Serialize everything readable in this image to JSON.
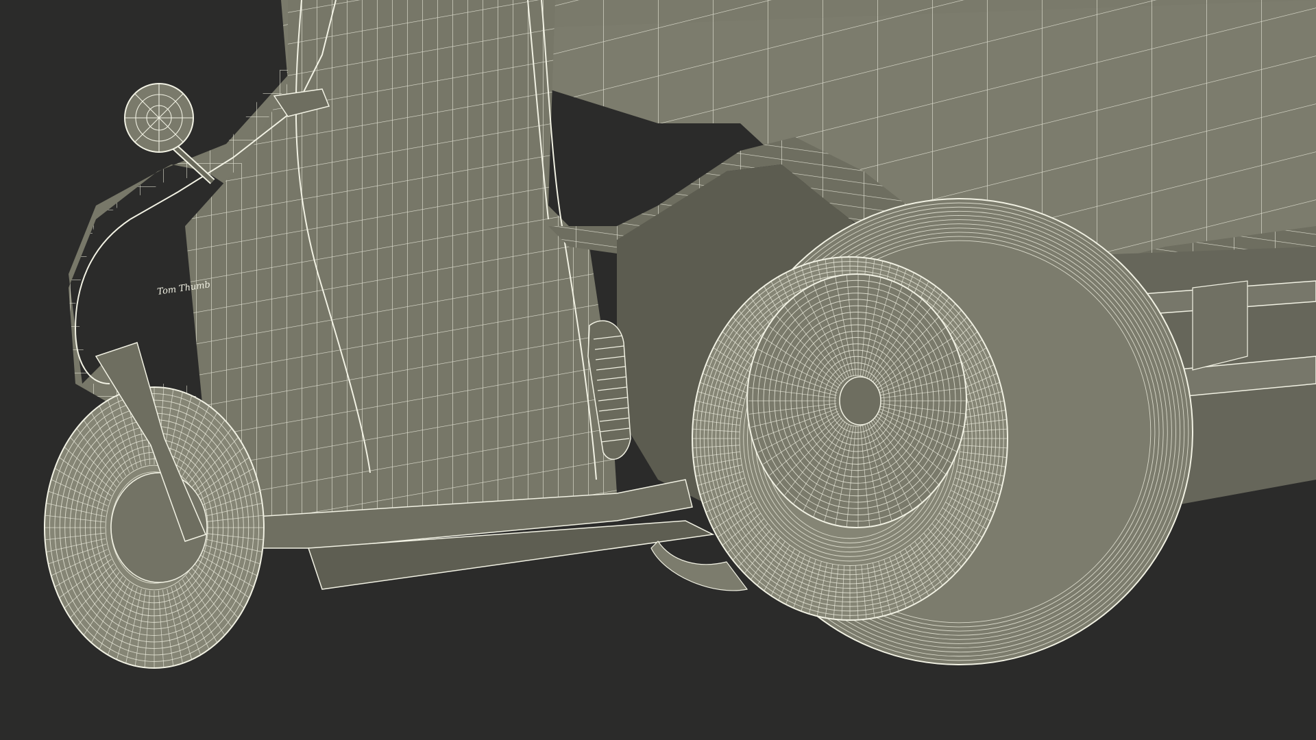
{
  "scene": {
    "subject": "wireframe-pickup-truck-underside",
    "colors": {
      "background": "#2b2b2a",
      "surface": "#7a7a6b",
      "surface_dark": "#6a6a5c",
      "surface_shadow": "#55554a",
      "wire": "#f2f2e4",
      "tire": "#8a8a7a"
    },
    "badge_text": "Tom Thumb"
  }
}
